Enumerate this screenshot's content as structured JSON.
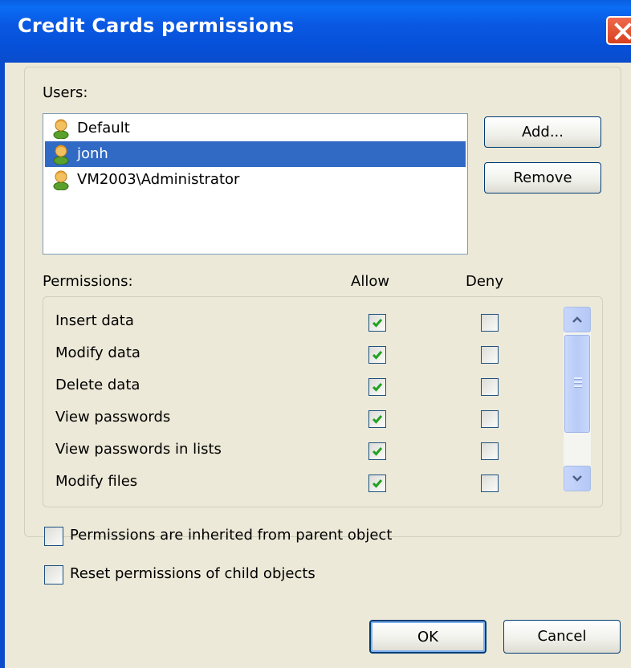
{
  "window": {
    "title": "Credit Cards permissions"
  },
  "users": {
    "label": "Users:",
    "items": [
      {
        "name": "Default",
        "selected": false
      },
      {
        "name": "jonh",
        "selected": true
      },
      {
        "name": "VM2003\\Administrator",
        "selected": false
      }
    ],
    "add_label": "Add...",
    "remove_label": "Remove"
  },
  "permissions": {
    "label": "Permissions:",
    "allow_header": "Allow",
    "deny_header": "Deny",
    "rows": [
      {
        "name": "Insert data",
        "allow": true,
        "deny": false
      },
      {
        "name": "Modify data",
        "allow": true,
        "deny": false
      },
      {
        "name": "Delete data",
        "allow": true,
        "deny": false
      },
      {
        "name": "View passwords",
        "allow": true,
        "deny": false
      },
      {
        "name": "View passwords in lists",
        "allow": true,
        "deny": false
      },
      {
        "name": "Modify files",
        "allow": true,
        "deny": false
      }
    ]
  },
  "options": {
    "inherited_label": "Permissions are inherited from parent object",
    "inherited_checked": false,
    "reset_label": "Reset permissions of child objects",
    "reset_checked": false
  },
  "footer": {
    "ok_label": "OK",
    "cancel_label": "Cancel"
  },
  "colors": {
    "titlebar": "#0a5fe0",
    "selection": "#316ac5",
    "check": "#21a121",
    "dialog_bg": "#ece9d8"
  }
}
